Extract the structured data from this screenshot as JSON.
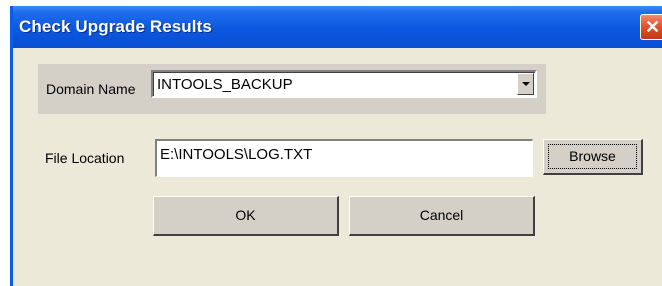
{
  "dialog": {
    "title": "Check Upgrade Results",
    "close_symbol": "✕"
  },
  "domain": {
    "label": "Domain Name",
    "selected_value": "INTOOLS_BACKUP"
  },
  "file": {
    "label": "File Location",
    "value": "E:\\INTOOLS\\LOG.TXT",
    "browse_label": "Browse"
  },
  "actions": {
    "ok_label": "OK",
    "cancel_label": "Cancel"
  },
  "colors": {
    "titlebar": "#0a58e0",
    "dialog_background": "#ece9d8",
    "close_button": "#e0502a"
  },
  "icons": {
    "close": "close-icon",
    "dropdown": "chevron-down-icon"
  }
}
